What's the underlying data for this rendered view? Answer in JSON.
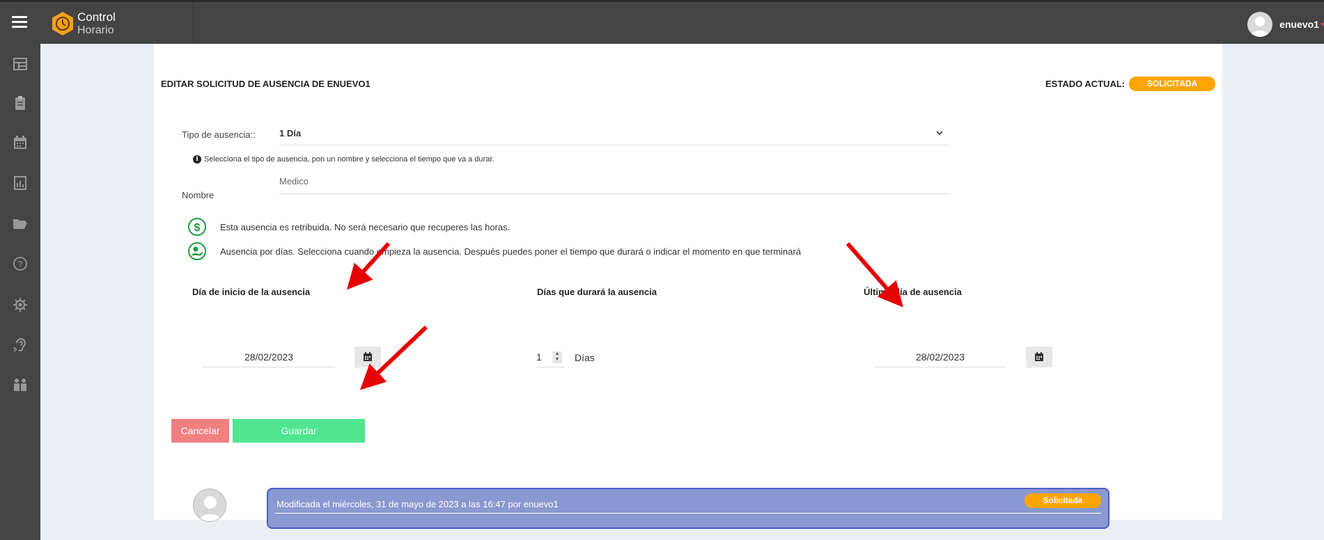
{
  "app": {
    "title": "Control",
    "subtitle": "Horario"
  },
  "user": {
    "name": "enuevo1"
  },
  "sidebar": {
    "items": [
      {
        "icon": "dashboard-icon"
      },
      {
        "icon": "clipboard-icon"
      },
      {
        "icon": "calendar-icon"
      },
      {
        "icon": "report-icon"
      },
      {
        "icon": "folder-icon"
      },
      {
        "icon": "help-icon"
      },
      {
        "icon": "gear-icon"
      },
      {
        "icon": "hearing-icon"
      },
      {
        "icon": "people-icon"
      }
    ]
  },
  "form": {
    "title": "EDITAR SOLICITUD DE AUSENCIA DE ENUEVO1",
    "status_label": "ESTADO ACTUAL:",
    "status_value": "SOLICITADA",
    "type_label": "Tipo de ausencia::",
    "type_value": "1 Día",
    "hint": "Selecciona el tipo de ausencia, pon un nombre y selecciona el tiempo que va a durar.",
    "name_label": "Nombre",
    "name_value": "Medico",
    "info_paid": "Esta ausencia es retribuida. No será necesario que recuperes las horas.",
    "info_days": "Ausencia por días. Selecciona cuando empieza la ausencia. Después puedes poner el tiempo que durará o indicar el momento en que terminará",
    "start_label": "Día de inicio de la ausencia",
    "start_value": "28/02/2023",
    "duration_label": "Días que durará la ausencia",
    "duration_value": "1",
    "duration_unit": "Días",
    "end_label": "Último día de ausencia",
    "end_value": "28/02/2023",
    "cancel_label": "Cancelar",
    "save_label": "Guardar"
  },
  "history": {
    "text": "Modificada el miércoles, 31 de mayo de 2023 a las 16:47 por enuevo1",
    "badge": "Solicitada"
  },
  "colors": {
    "topbar": "#444444",
    "accent": "#ffa500",
    "cancel": "#f08080",
    "save": "#50e691",
    "history_bg": "#8a99d1",
    "annotation": "#e60000"
  }
}
